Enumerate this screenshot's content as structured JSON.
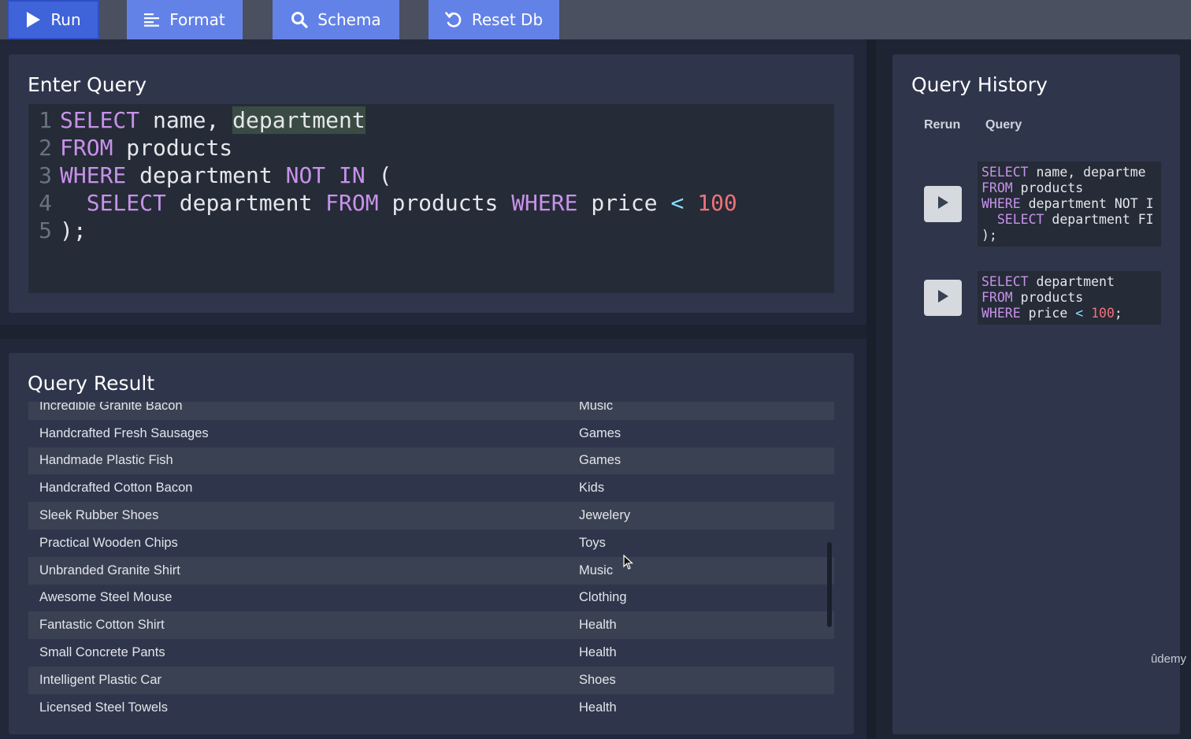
{
  "toolbar": {
    "run_label": "Run",
    "format_label": "Format",
    "schema_label": "Schema",
    "reset_label": "Reset Db"
  },
  "editor": {
    "title": "Enter Query",
    "lines": [
      {
        "n": "1",
        "tokens": [
          [
            "kw",
            "SELECT"
          ],
          [
            "id",
            " name, "
          ],
          [
            "idhl",
            "department"
          ]
        ]
      },
      {
        "n": "2",
        "tokens": [
          [
            "kw",
            "FROM"
          ],
          [
            "id",
            " products"
          ]
        ]
      },
      {
        "n": "3",
        "tokens": [
          [
            "kw",
            "WHERE"
          ],
          [
            "id",
            " department "
          ],
          [
            "kw",
            "NOT IN"
          ],
          [
            "id",
            " ("
          ]
        ]
      },
      {
        "n": "4",
        "tokens": [
          [
            "id",
            "  "
          ],
          [
            "kw",
            "SELECT"
          ],
          [
            "id",
            " department "
          ],
          [
            "kw",
            "FROM"
          ],
          [
            "id",
            " products "
          ],
          [
            "kw",
            "WHERE"
          ],
          [
            "id",
            " price "
          ],
          [
            "op",
            "<"
          ],
          [
            "id",
            " "
          ],
          [
            "num",
            "100"
          ]
        ]
      },
      {
        "n": "5",
        "tokens": [
          [
            "id",
            ");"
          ]
        ]
      }
    ]
  },
  "result": {
    "title": "Query Result",
    "rows": [
      [
        "Incredible Granite Bacon",
        "Music"
      ],
      [
        "Handcrafted Fresh Sausages",
        "Games"
      ],
      [
        "Handmade Plastic Fish",
        "Games"
      ],
      [
        "Handcrafted Cotton Bacon",
        "Kids"
      ],
      [
        "Sleek Rubber Shoes",
        "Jewelery"
      ],
      [
        "Practical Wooden Chips",
        "Toys"
      ],
      [
        "Unbranded Granite Shirt",
        "Music"
      ],
      [
        "Awesome Steel Mouse",
        "Clothing"
      ],
      [
        "Fantastic Cotton Shirt",
        "Health"
      ],
      [
        "Small Concrete Pants",
        "Health"
      ],
      [
        "Intelligent Plastic Car",
        "Shoes"
      ],
      [
        "Licensed Steel Towels",
        "Health"
      ]
    ]
  },
  "history": {
    "title": "Query History",
    "col_rerun": "Rerun",
    "col_query": "Query",
    "entries": [
      {
        "lines": [
          [
            [
              "kw",
              "SELECT"
            ],
            [
              "id",
              " name, departme"
            ]
          ],
          [
            [
              "kw",
              "FROM"
            ],
            [
              "id",
              " products"
            ]
          ],
          [
            [
              "kw",
              "WHERE"
            ],
            [
              "id",
              " department NOT I"
            ]
          ],
          [
            [
              "id",
              "  "
            ],
            [
              "kw",
              "SELECT"
            ],
            [
              "id",
              " department FI"
            ]
          ],
          [
            [
              "id",
              ");"
            ]
          ]
        ]
      },
      {
        "lines": [
          [
            [
              "kw",
              "SELECT"
            ],
            [
              "id",
              " department"
            ]
          ],
          [
            [
              "kw",
              "FROM"
            ],
            [
              "id",
              " products"
            ]
          ],
          [
            [
              "kw",
              "WHERE"
            ],
            [
              "id",
              " price "
            ],
            [
              "op",
              "<"
            ],
            [
              "id",
              " "
            ],
            [
              "num",
              "100"
            ],
            [
              "id",
              ";"
            ]
          ]
        ]
      }
    ]
  },
  "watermark": "ûdemy",
  "colors": {
    "accent": "#6382e8",
    "run_button": "#3f63d9",
    "keyword": "#c792ea",
    "number": "#f07178",
    "operator": "#89ddff"
  }
}
